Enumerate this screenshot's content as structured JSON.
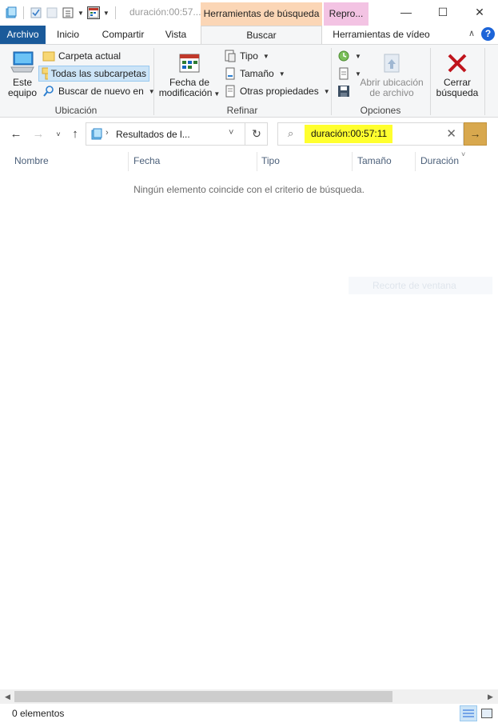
{
  "window": {
    "title": "duración:00:57...",
    "context_search_tab": "Herramientas de búsqueda",
    "context_play_tab": "Repro...",
    "minimize_glyph": "—",
    "maximize_glyph": "☐",
    "close_glyph": "✕"
  },
  "tabs": {
    "archivo": "Archivo",
    "inicio": "Inicio",
    "compartir": "Compartir",
    "vista": "Vista",
    "buscar": "Buscar",
    "video_tools": "Herramientas de vídeo",
    "help": "?"
  },
  "ribbon": {
    "ubicacion": {
      "label": "Ubicación",
      "este_equipo_l1": "Este",
      "este_equipo_l2": "equipo",
      "carpeta_actual": "Carpeta actual",
      "todas_subcarpetas": "Todas las subcarpetas",
      "buscar_de_nuevo": "Buscar de nuevo en"
    },
    "refinar": {
      "label": "Refinar",
      "fecha_l1": "Fecha de",
      "fecha_l2": "modificación",
      "tipo": "Tipo",
      "tamano": "Tamaño",
      "otras": "Otras propiedades"
    },
    "opciones": {
      "label": "Opciones",
      "abrir_l1": "Abrir ubicación",
      "abrir_l2": "de archivo"
    },
    "cerrar": {
      "l1": "Cerrar",
      "l2": "búsqueda"
    }
  },
  "address": {
    "path": "Resultados de l...",
    "search_value": "duración:00:57:11"
  },
  "columns": [
    "Nombre",
    "Fecha",
    "Tipo",
    "Tamaño",
    "Duración"
  ],
  "content": {
    "empty_message": "Ningún elemento coincide con el criterio de búsqueda.",
    "ghost_tooltip": "Recorte de ventana"
  },
  "status": {
    "count": "0 elementos"
  },
  "colors": {
    "archivo_tab": "#1a5a9a",
    "search_highlight": "#ffff2e",
    "ctx_search": "#fbd6b6",
    "ctx_play": "#f3c3e3",
    "go_button": "#d8a84e",
    "close_search_x": "#c0141c"
  }
}
